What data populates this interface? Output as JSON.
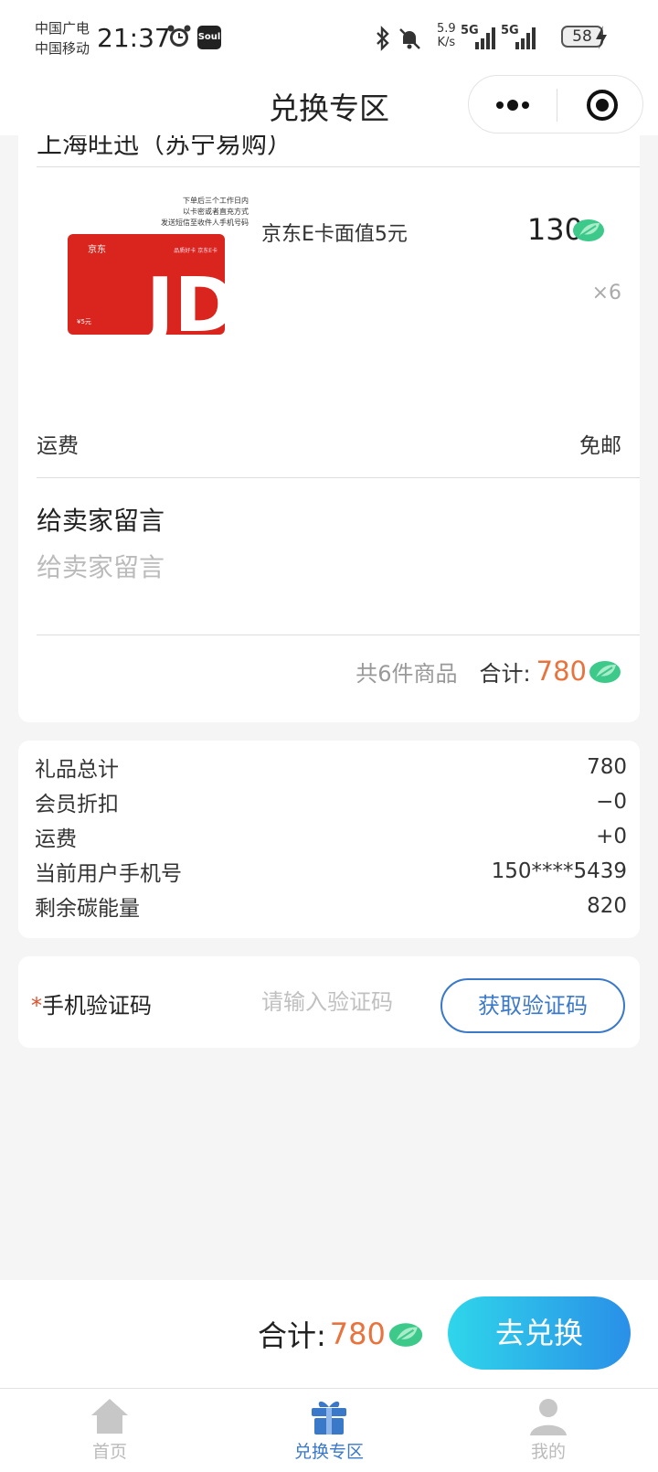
{
  "status_bar": {
    "carrier_1": "中国广电",
    "carrier_2": "中国移动",
    "time": "21:37",
    "app_badge": "Soul",
    "net_speed_value": "5.9",
    "net_speed_unit": "K/s",
    "signal_1": "5G",
    "signal_2": "5G",
    "battery": "58",
    "icons": [
      "alarm-icon",
      "soul-app-icon",
      "bluetooth-icon",
      "mute-icon",
      "signal-icon",
      "signal-icon",
      "battery-icon",
      "charging-icon"
    ]
  },
  "header": {
    "title": "兑换专区",
    "menu_icon": "more-dots-icon",
    "close_icon": "target-close-icon"
  },
  "order": {
    "store_name": "上海旺迅（苏宁易购）",
    "product": {
      "name": "京东E卡面值5元",
      "price": "130",
      "quantity": "×6",
      "image_caption_lines": [
        "下单后三个工作日内",
        "以卡密或者直充方式",
        "发送短信至收件人手机号码"
      ],
      "card_brand": "京东",
      "card_logo": "JD",
      "card_face_value": "¥5元",
      "card_slogan": "品质好卡 京东E卡"
    },
    "shipping_label": "运费",
    "shipping_value": "免邮",
    "message_title": "给卖家留言",
    "message_placeholder": "给卖家留言",
    "item_count": "共6件商品",
    "subtotal_label": "合计:",
    "subtotal_value": "780"
  },
  "summary": {
    "rows": [
      {
        "label": "礼品总计",
        "value": "780"
      },
      {
        "label": "会员折扣",
        "value": "−0"
      },
      {
        "label": "运费",
        "value": "+0"
      },
      {
        "label": "当前用户手机号",
        "value": "150****5439"
      },
      {
        "label": "剩余碳能量",
        "value": "820"
      }
    ]
  },
  "verification": {
    "required_mark": "*",
    "label": "手机验证码",
    "placeholder": "请输入验证码",
    "button": "获取验证码"
  },
  "submit": {
    "total_label": "合计:",
    "total_value": "780",
    "button": "去兑换"
  },
  "tabs": [
    {
      "label": "首页",
      "icon": "home-icon",
      "active": false
    },
    {
      "label": "兑换专区",
      "icon": "gift-icon",
      "active": true
    },
    {
      "label": "我的",
      "icon": "user-icon",
      "active": false
    }
  ],
  "colors": {
    "accent_orange": "#e8733d",
    "link_blue": "#3a78c9",
    "leaf_green": "#3cc98a",
    "button_gradient_start": "#2fd6ea",
    "button_gradient_end": "#2a8fe8",
    "jd_red": "#d9251d"
  }
}
